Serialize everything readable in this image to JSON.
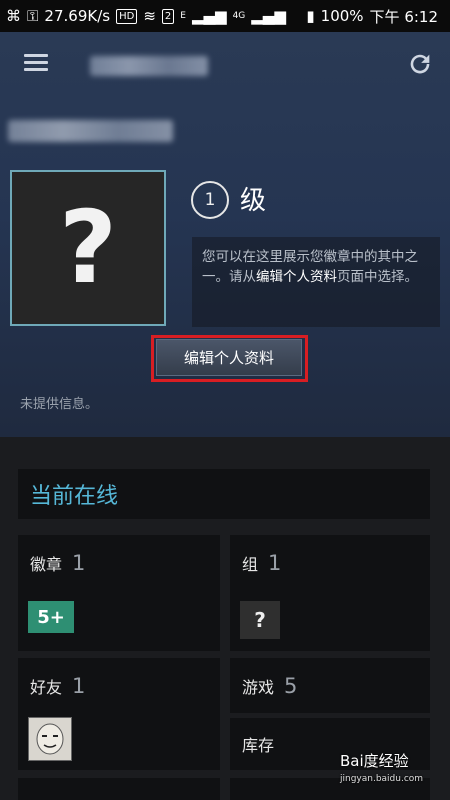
{
  "statusbar": {
    "speed": "27.69K/s",
    "hd": "HD",
    "sim": "2",
    "net1": "E",
    "net2": "4G",
    "battery": "100%",
    "time": "下午 6:12"
  },
  "profile": {
    "level_number": "1",
    "level_suffix": "级",
    "badge_info_part1": "您可以在这里展示您徽章中的其中之一。请从",
    "badge_info_link": "编辑个人资料",
    "badge_info_part2": "页面中选择。",
    "edit_button": "编辑个人资料",
    "no_info": "未提供信息。"
  },
  "online": {
    "label": "当前在线"
  },
  "cards": [
    {
      "label": "徽章",
      "count": "1",
      "badge_text": "5+"
    },
    {
      "label": "组",
      "count": "1",
      "icon_text": "?"
    },
    {
      "label": "好友",
      "count": "1"
    },
    {
      "label": "游戏",
      "count": "5"
    },
    {
      "label": "库存"
    }
  ],
  "watermark": {
    "brand": "Bai度经验",
    "url": "jingyan.baidu.com"
  },
  "colors": {
    "accent": "#56b8d8",
    "highlight": "#d81e23",
    "badge": "#2e8f73"
  }
}
